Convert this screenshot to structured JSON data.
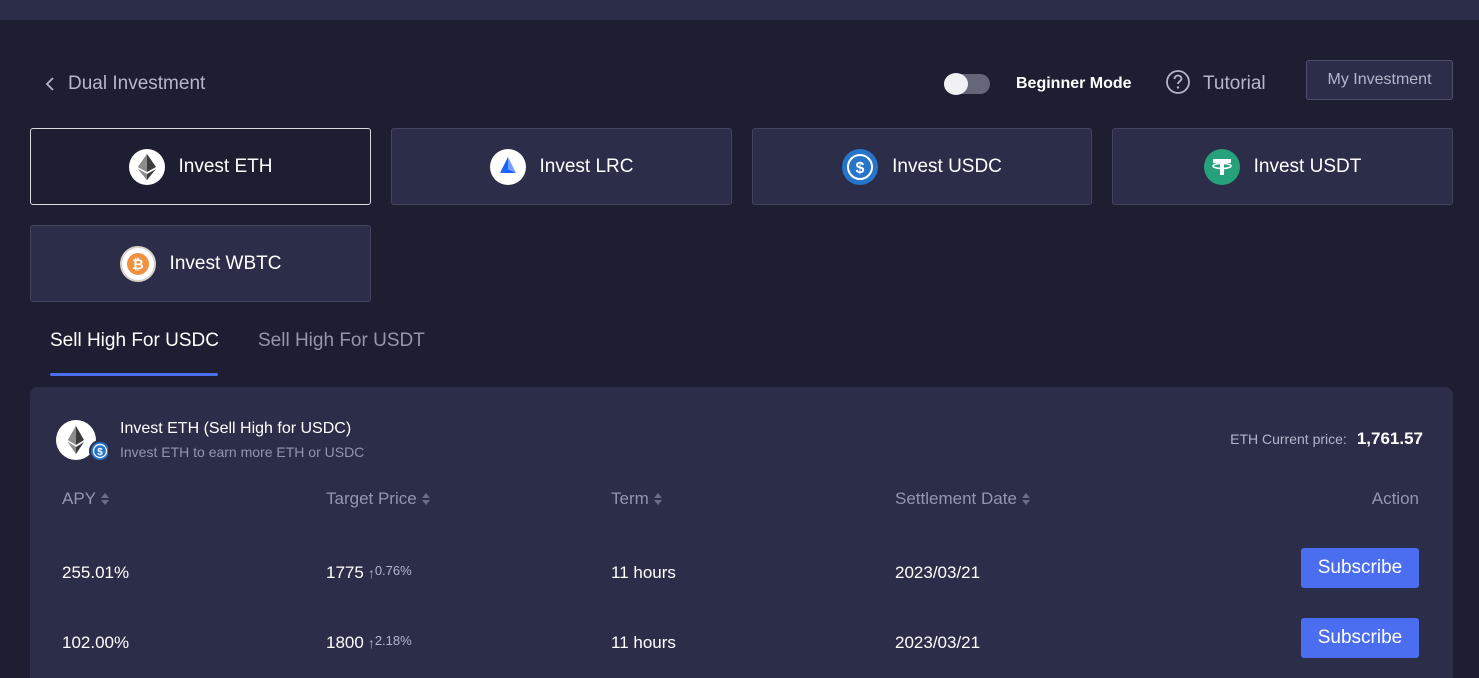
{
  "header": {
    "back_title": "Dual Investment",
    "beginner_mode_label": "Beginner Mode",
    "beginner_mode_on": false,
    "tutorial_label": "Tutorial",
    "my_investment_label": "My Investment"
  },
  "coins": [
    {
      "label": "Invest ETH",
      "icon": "eth-icon",
      "active": true
    },
    {
      "label": "Invest LRC",
      "icon": "lrc-icon",
      "active": false
    },
    {
      "label": "Invest USDC",
      "icon": "usdc-icon",
      "active": false
    },
    {
      "label": "Invest USDT",
      "icon": "usdt-icon",
      "active": false
    },
    {
      "label": "Invest WBTC",
      "icon": "wbtc-icon",
      "active": false
    }
  ],
  "tabs": [
    {
      "label": "Sell High For USDC",
      "active": true
    },
    {
      "label": "Sell High For USDT",
      "active": false
    }
  ],
  "panel": {
    "title": "Invest ETH (Sell High for USDC)",
    "subtitle": "Invest ETH to earn more ETH or USDC",
    "current_price_label": "ETH Current price:",
    "current_price_value": "1,761.57",
    "columns": [
      "APY",
      "Target Price",
      "Term",
      "Settlement Date",
      "Action"
    ],
    "rows": [
      {
        "apy": "255.01%",
        "target": "1775",
        "change": "0.76%",
        "term": "11 hours",
        "date": "2023/03/21",
        "action": "Subscribe"
      },
      {
        "apy": "102.00%",
        "target": "1800",
        "change": "2.18%",
        "term": "11 hours",
        "date": "2023/03/21",
        "action": "Subscribe"
      }
    ]
  },
  "colors": {
    "background": "#1e1e33",
    "card": "#2c2d48",
    "accent": "#4b6ef0",
    "muted_text": "#9496ad"
  }
}
